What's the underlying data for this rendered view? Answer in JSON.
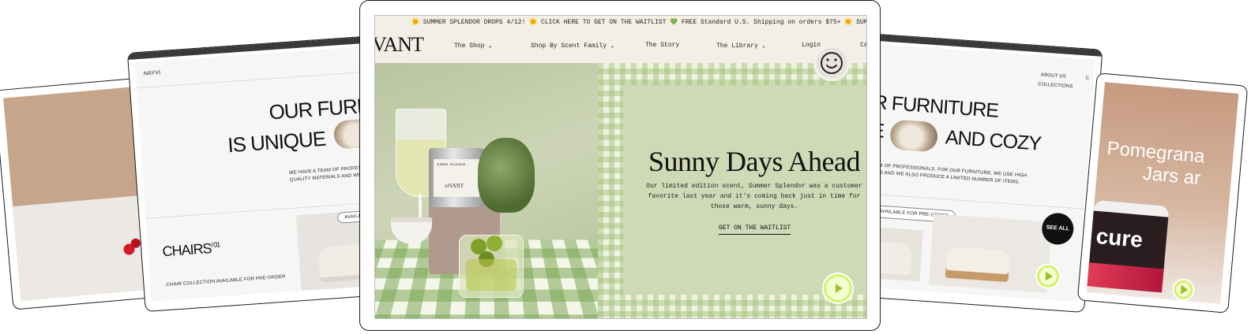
{
  "main": {
    "ticker_text": "🌞 SUMMER SPLENDOR DROPS 4/12! 🌞 CLICK HERE TO GET ON THE WAITLIST 💚 FREE Standard U.S. Shipping on orders $75+ 🌞 SUMMER SPLENDOR DROPS 4/12",
    "logo": "VANT",
    "nav": [
      "The Shop",
      "Shop By Scent Family",
      "The Story",
      "The Library",
      "Login",
      "Ca"
    ],
    "hero_title": "Sunny Days Ahead",
    "hero_body": "Our limited edition scent, Summer Splendor was a customer favorite last year and it's coming back just in time for those warm, sunny days.",
    "cta": "GET ON THE WAITLIST",
    "can_label": "SUMMER SPLENDOR",
    "can_brand": "otVANT"
  },
  "left_card": {
    "brand": "NAYVI",
    "headline_1": "OUR FURN",
    "headline_2": "IS UNIQUE",
    "body": "WE HAVE A TEAM OF PROFESS\nQUALITY MATERIALS AND WE",
    "section": "CHAIRS",
    "section_num": "/ 01",
    "pill": "AVAILABLE",
    "caption": "CHAIR COLLECTION AVAILABLE FOR PRE-ORDER"
  },
  "right_card": {
    "nav_1": "ABOUT US",
    "nav_2": "COLLECTIONS",
    "nav_partial": "C",
    "headline_1": "R FURNITURE",
    "headline_2": "E",
    "headline_3": "AND COZY",
    "body": "TEAM OF PROFESSIONALS. FOR OUR FURNITURE, WE USE HIGH\nRIALS AND WE ALSO PRODUCE A LIMITED NUMBER OF ITEMS.",
    "pill": "AVAILABLE FOR PRE-ORDER",
    "see_all": "SEE ALL"
  },
  "far_right_card": {
    "headline_1": "Pomegrana",
    "headline_2": "Jars ar",
    "brand": "cure"
  },
  "colors": {
    "accent_green": "#d6f06b",
    "sage": "#cfd9b6",
    "cream": "#f4efe6"
  }
}
